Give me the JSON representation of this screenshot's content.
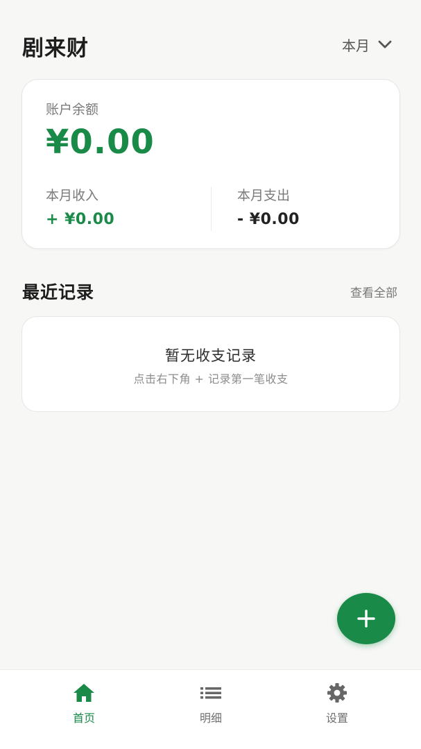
{
  "header": {
    "title": "剧来财",
    "period": "本月",
    "period_icon": "chevron-down-icon"
  },
  "balance": {
    "label": "账户余额",
    "value": "¥0.00",
    "income_label": "本月收入",
    "income_value": "+ ¥0.00",
    "expense_label": "本月支出",
    "expense_value": "- ¥0.00"
  },
  "recent": {
    "title": "最近记录",
    "view_all": "查看全部",
    "empty_title": "暂无收支记录",
    "empty_hint": "点击右下角 + 记录第一笔收支"
  },
  "fab": {
    "icon": "plus-icon"
  },
  "nav": {
    "items": [
      {
        "label": "首页",
        "icon": "home-icon",
        "active": true
      },
      {
        "label": "明细",
        "icon": "list-icon",
        "active": false
      },
      {
        "label": "设置",
        "icon": "gear-icon",
        "active": false
      }
    ]
  },
  "colors": {
    "accent": "#1a8a48",
    "background": "#f7f7f5",
    "card": "#ffffff",
    "text_muted": "#7a7a7a"
  }
}
